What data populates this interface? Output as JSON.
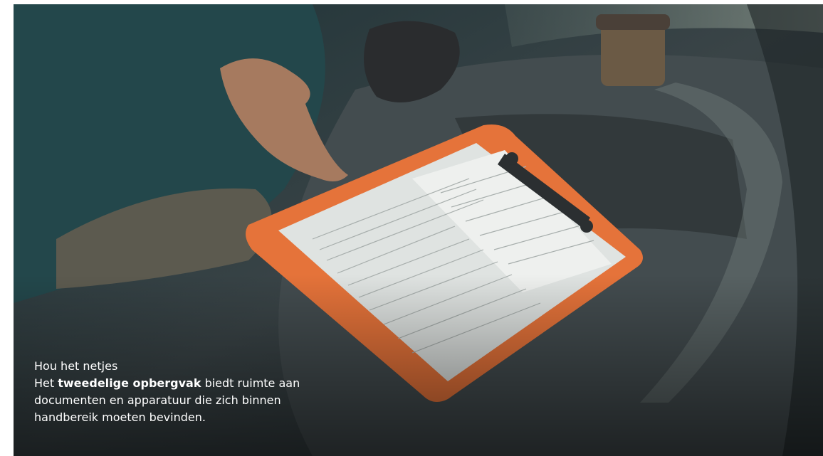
{
  "caption": {
    "title": "Hou het netjes",
    "text_before": "Het ",
    "text_bold": "tweedelige opbergvak",
    "text_after": " biedt ruimte aan documenten en apparatuur die zich binnen handbereik moeten bevinden."
  },
  "photo": {
    "subject": "Clipboard with documents on a vehicle dashboard storage compartment",
    "colors": {
      "clipboard": "#e5733a",
      "dashboard": "#3d4649",
      "paper": "#dfe3e1",
      "shirt": "#2c6b70",
      "caption_text": "#ffffff"
    }
  }
}
